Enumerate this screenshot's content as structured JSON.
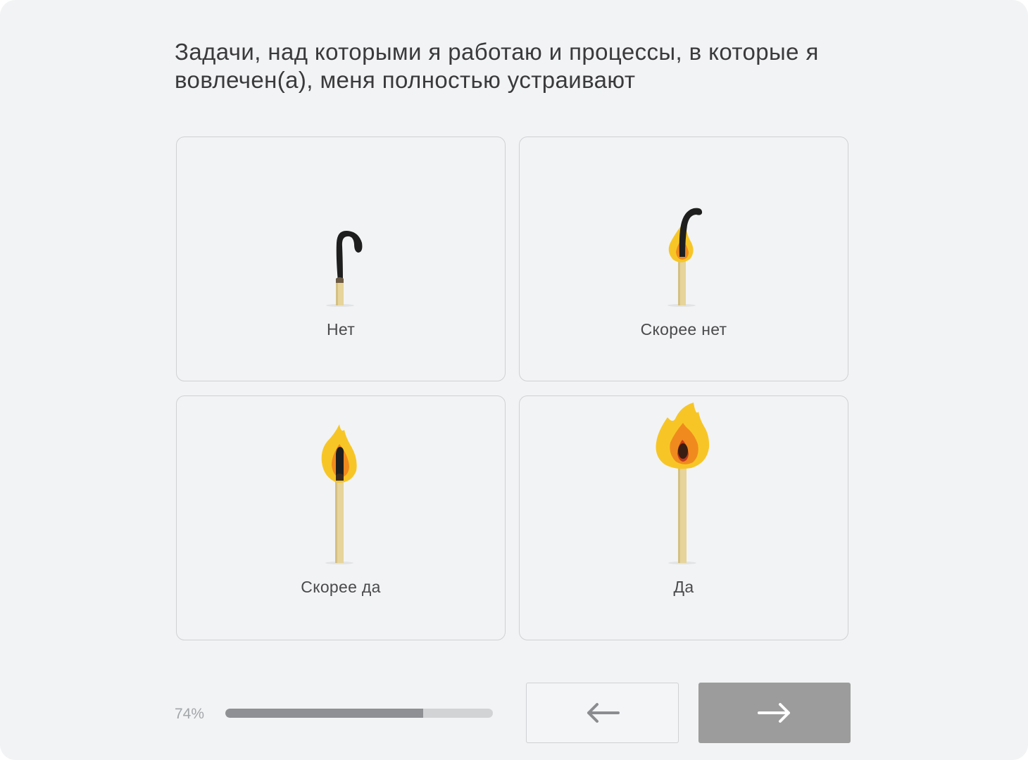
{
  "question": "Задачи, над которыми я работаю и процессы, в которые я вовлечен(а), меня полностью устраивают",
  "options": [
    {
      "label": "Нет",
      "icon": "burnt-match-icon"
    },
    {
      "label": "Скорее нет",
      "icon": "dying-match-icon"
    },
    {
      "label": "Скорее да",
      "icon": "lit-match-icon"
    },
    {
      "label": "Да",
      "icon": "blazing-match-icon"
    }
  ],
  "progress": {
    "text": "74%",
    "value": 0.74
  },
  "navigation": {
    "back_icon": "arrow-left-icon",
    "next_icon": "arrow-right-icon"
  },
  "colors": {
    "background": "#f2f3f4",
    "card_border": "#cfd1d4",
    "progress_fill": "#8e9093",
    "progress_track": "#d2d3d5",
    "next_button": "#9c9c9c",
    "flame_outer": "#f7c626",
    "flame_inner": "#f08a1e",
    "match_stick": "#e6d49a"
  }
}
